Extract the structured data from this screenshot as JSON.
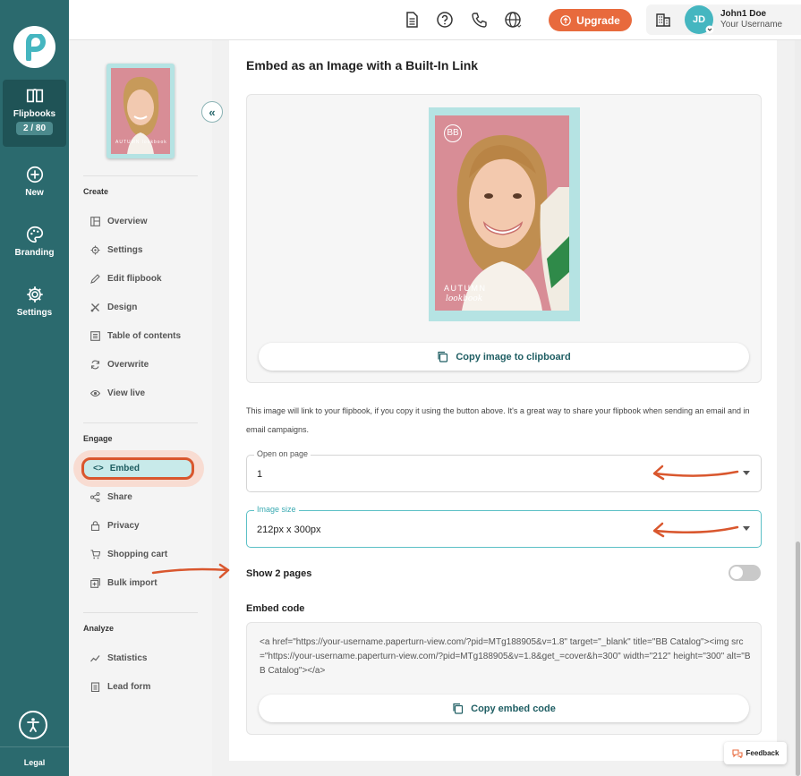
{
  "rail": {
    "items": [
      {
        "label": "Flipbooks",
        "badge": "2 / 80"
      },
      {
        "label": "New"
      },
      {
        "label": "Branding"
      },
      {
        "label": "Settings"
      }
    ],
    "legal": "Legal"
  },
  "topbar": {
    "upgrade_label": "Upgrade",
    "avatar_initials": "JD",
    "user_name": "John1 Doe",
    "user_sub": "Your Username"
  },
  "menu": {
    "create_title": "Create",
    "create_items": [
      "Overview",
      "Settings",
      "Edit flipbook",
      "Design",
      "Table of contents",
      "Overwrite",
      "View live"
    ],
    "engage_title": "Engage",
    "engage_items": [
      "Embed",
      "Share",
      "Privacy",
      "Shopping cart",
      "Bulk import"
    ],
    "analyze_title": "Analyze",
    "analyze_items": [
      "Statistics",
      "Lead form"
    ],
    "thumb_text": "AUTUMN lookbook"
  },
  "main": {
    "title": "Embed as an Image with a Built-In Link",
    "cover_brand": "BB",
    "cover_title": "AUTUMN",
    "cover_script": "lookbook",
    "copy_image_label": "Copy image to clipboard",
    "description": "This image will link to your flipbook, if you copy it using the button above. It's a great way to share your flipbook when sending an email and in email campaigns.",
    "open_on_page": {
      "label": "Open on page",
      "value": "1"
    },
    "image_size": {
      "label": "Image size",
      "value": "212px x 300px"
    },
    "show_pages_label": "Show 2 pages",
    "show_pages_on": false,
    "embed_code_label": "Embed code",
    "embed_code": "<a href=\"https://your-username.paperturn-view.com/?pid=MTg188905&v=1.8\" target=\"_blank\" title=\"BB Catalog\"><img src=\"https://your-username.paperturn-view.com/?pid=MTg188905&v=1.8&get_=cover&h=300\" width=\"212\" height=\"300\" alt=\"BB Catalog\"></a>",
    "copy_code_label": "Copy embed code"
  },
  "feedback_label": "Feedback",
  "colors": {
    "rail": "#2b6a6e",
    "accent": "#e86a3d",
    "teal_text": "#1f5e63",
    "annotation": "#d9572e"
  }
}
